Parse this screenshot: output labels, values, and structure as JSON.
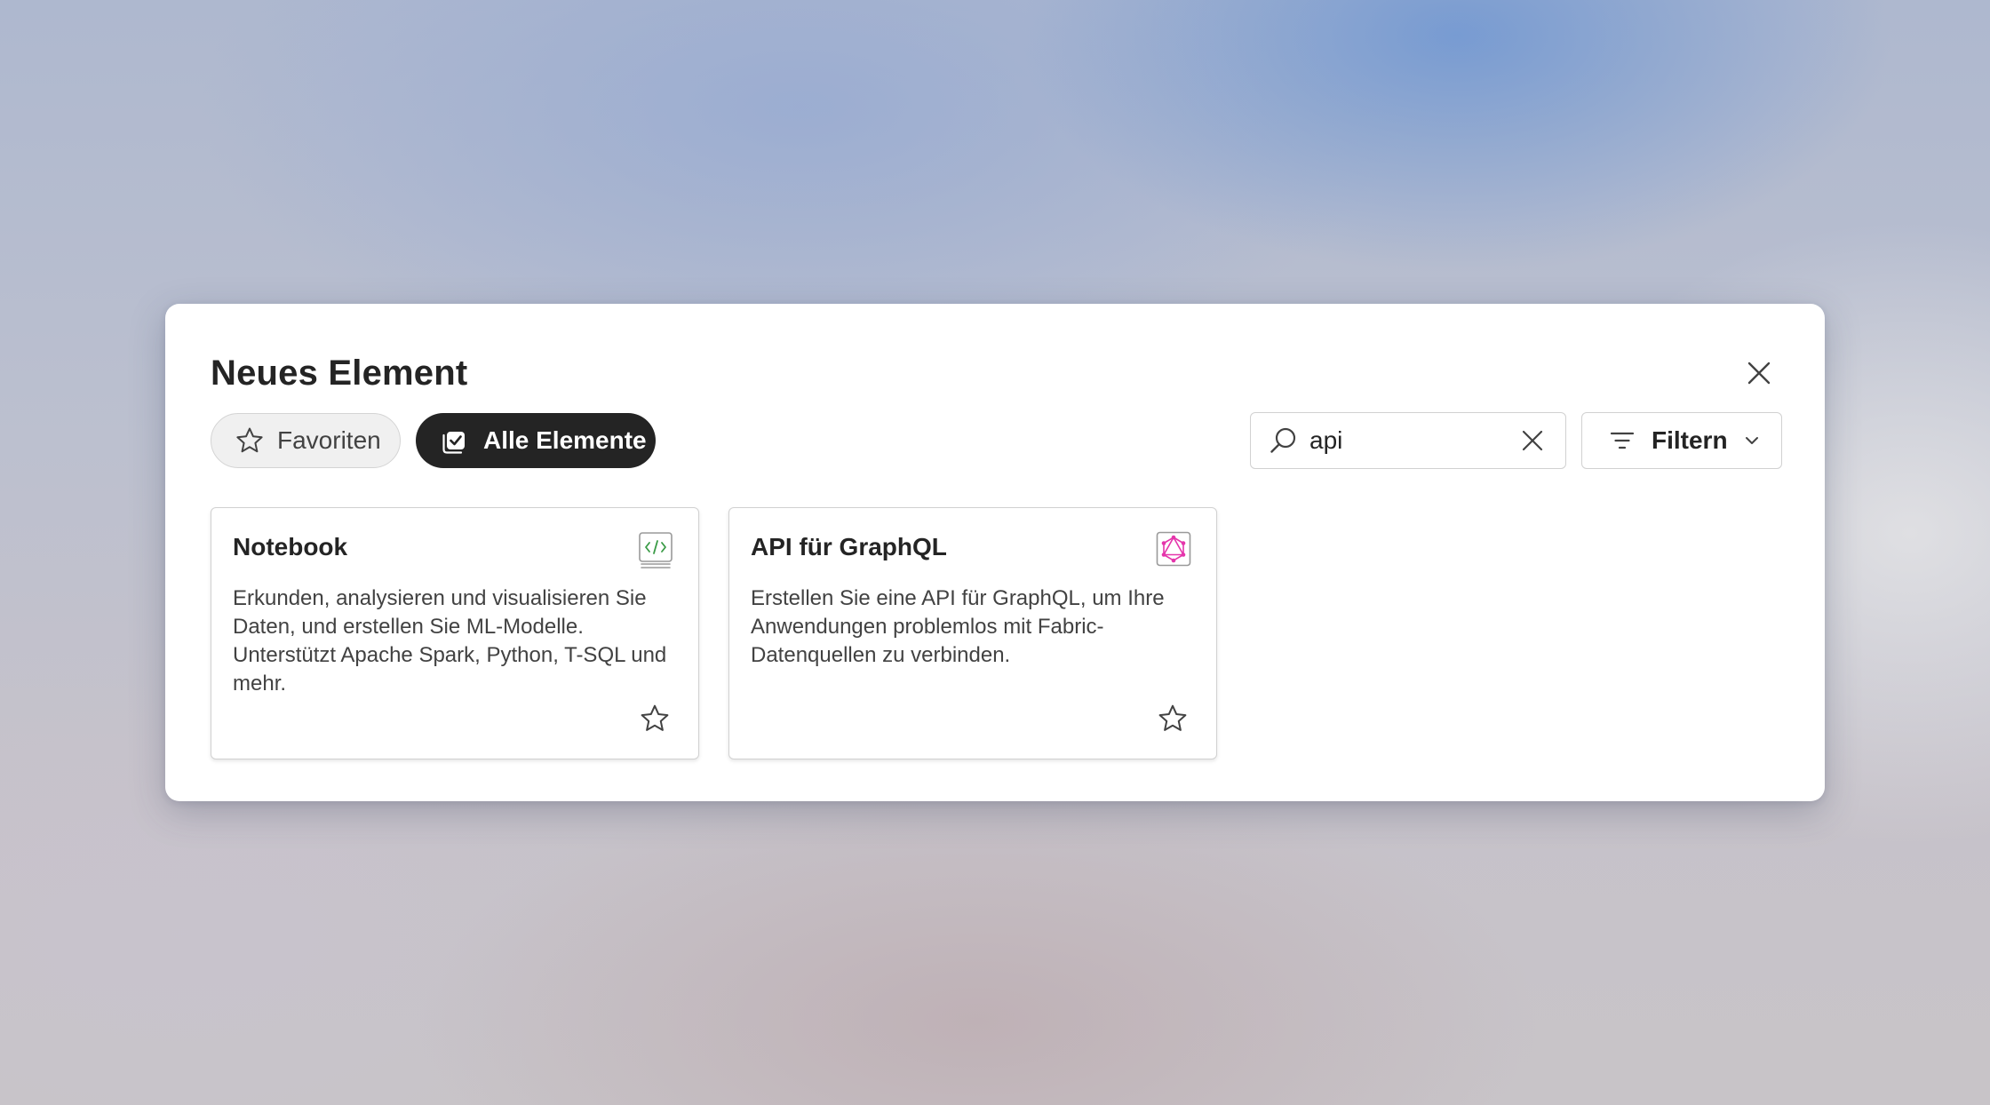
{
  "dialog": {
    "title": "Neues Element",
    "close_icon": "close-icon"
  },
  "tabs": [
    {
      "label": "Favoriten",
      "icon": "star-icon",
      "selected": false
    },
    {
      "label": "Alle Elemente",
      "icon": "checkbox-icon",
      "selected": true
    }
  ],
  "search": {
    "value": "api",
    "icon": "search-icon",
    "clear_icon": "dismiss-icon"
  },
  "filter": {
    "label": "Filtern",
    "icon": "filter-icon",
    "chevron": "chevron-down-icon"
  },
  "cards": [
    {
      "title": "Notebook",
      "description": "Erkunden, analysieren und visualisieren Sie Daten, und erstellen Sie ML-Modelle. Unterstützt Apache Spark, Python, T-SQL und mehr.",
      "icon": "notebook-icon",
      "favorite_icon": "star-icon"
    },
    {
      "title": "API für GraphQL",
      "description": "Erstellen Sie eine API für GraphQL, um Ihre Anwendungen problemlos mit Fabric-Datenquellen zu verbinden.",
      "icon": "graphql-icon",
      "favorite_icon": "star-icon"
    }
  ],
  "colors": {
    "selected_pill": "#242424",
    "notebook_accent": "#3a9b46",
    "graphql_accent": "#e535ab"
  }
}
